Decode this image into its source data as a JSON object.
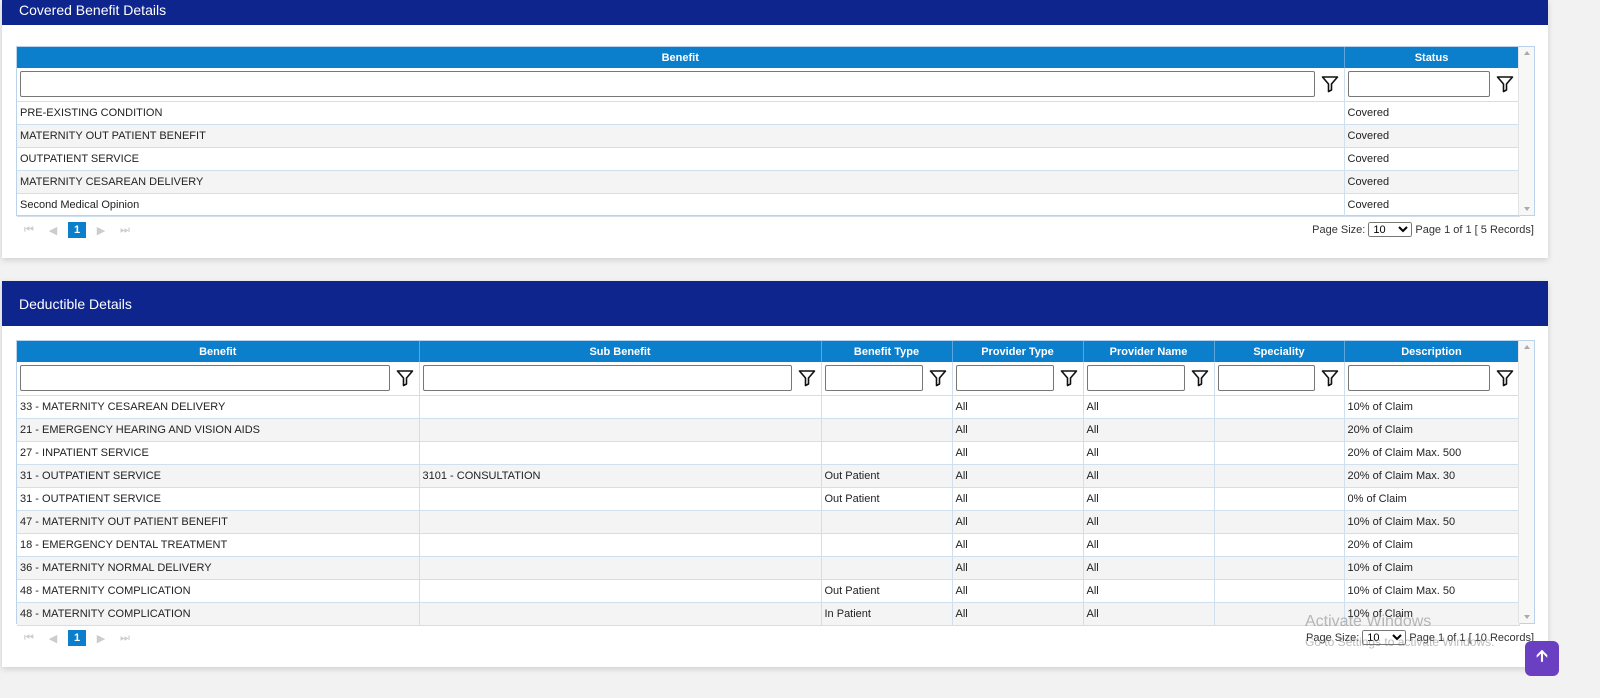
{
  "covered": {
    "title": "Covered Benefit Details",
    "columns": [
      "Benefit",
      "Status"
    ],
    "rows": [
      [
        "PRE-EXISTING CONDITION",
        "Covered"
      ],
      [
        "MATERNITY OUT PATIENT BENEFIT",
        "Covered"
      ],
      [
        "OUTPATIENT SERVICE",
        "Covered"
      ],
      [
        "MATERNITY CESAREAN DELIVERY",
        "Covered"
      ],
      [
        "Second Medical Opinion",
        "Covered"
      ]
    ],
    "pager": {
      "current": "1",
      "page_size_label": "Page Size:",
      "page_size": "10",
      "info": "Page 1 of 1 [ 5 Records]"
    }
  },
  "deductible": {
    "title": "Deductible Details",
    "columns": [
      "Benefit",
      "Sub Benefit",
      "Benefit Type",
      "Provider Type",
      "Provider Name",
      "Speciality",
      "Description"
    ],
    "rows": [
      [
        "33 - MATERNITY CESAREAN DELIVERY",
        "",
        "",
        "All",
        "All",
        "",
        "10% of Claim"
      ],
      [
        "21 - EMERGENCY HEARING AND VISION AIDS",
        "",
        "",
        "All",
        "All",
        "",
        "20% of Claim"
      ],
      [
        "27 - INPATIENT SERVICE",
        "",
        "",
        "All",
        "All",
        "",
        "20% of Claim Max. 500"
      ],
      [
        "31 - OUTPATIENT SERVICE",
        "3101 - CONSULTATION",
        "Out Patient",
        "All",
        "All",
        "",
        "20% of Claim Max. 30"
      ],
      [
        "31 - OUTPATIENT SERVICE",
        "",
        "Out Patient",
        "All",
        "All",
        "",
        "0% of Claim"
      ],
      [
        "47 - MATERNITY OUT PATIENT BENEFIT",
        "",
        "",
        "All",
        "All",
        "",
        "10% of Claim Max. 50"
      ],
      [
        "18 - EMERGENCY DENTAL TREATMENT",
        "",
        "",
        "All",
        "All",
        "",
        "20% of Claim"
      ],
      [
        "36 - MATERNITY NORMAL DELIVERY",
        "",
        "",
        "All",
        "All",
        "",
        "10% of Claim"
      ],
      [
        "48 - MATERNITY COMPLICATION",
        "",
        "Out Patient",
        "All",
        "All",
        "",
        "10% of Claim Max. 50"
      ],
      [
        "48 - MATERNITY COMPLICATION",
        "",
        "In Patient",
        "All",
        "All",
        "",
        "10% of Claim"
      ]
    ],
    "pager": {
      "current": "1",
      "page_size_label": "Page Size:",
      "page_size": "10",
      "info": "Page 1 of 1 [ 10 Records]"
    }
  },
  "watermark": {
    "line1": "Activate Windows",
    "line2": "Go to Settings to activate Windows."
  },
  "colors": {
    "header": "#0d258c",
    "grid_header": "#0b7fcc",
    "scroll_top": "#6a3fc2"
  }
}
